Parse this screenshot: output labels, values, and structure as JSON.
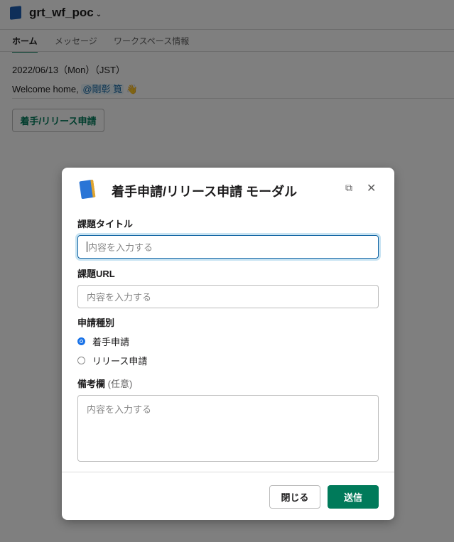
{
  "app": {
    "workspace_name": "grt_wf_poc",
    "tabs": [
      {
        "label": "ホーム",
        "active": true
      },
      {
        "label": "メッセージ"
      },
      {
        "label": "ワークスペース情報"
      }
    ],
    "date_line": "2022/06/13（Mon）（JST）",
    "welcome_prefix": "Welcome home,",
    "mention": "@剛彰 筧",
    "wave_emoji": "👋",
    "action_button": "着手/リリース申請"
  },
  "modal": {
    "title": "着手申請/リリース申請 モーダル",
    "fields": [
      {
        "label": "課題タイトル",
        "placeholder": "内容を入力する"
      },
      {
        "label": "課題URL",
        "placeholder": "内容を入力する"
      },
      {
        "label": "申請種別",
        "options": [
          {
            "label": "着手申請",
            "selected": true
          },
          {
            "label": "リリース申請",
            "selected": false
          }
        ]
      },
      {
        "label": "備考欄",
        "optional": "(任意)",
        "placeholder": "内容を入力する"
      }
    ],
    "close_button": "閉じる",
    "submit_button": "送信"
  },
  "colors": {
    "accent": "#007a5a",
    "focus": "#1264a3"
  }
}
